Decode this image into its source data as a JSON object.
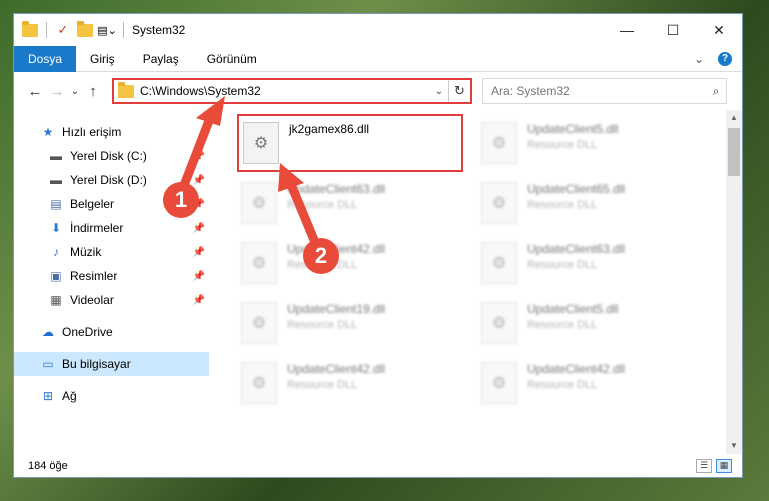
{
  "window": {
    "title": "System32",
    "controls": {
      "minimize": "—",
      "maximize": "☐",
      "close": "✕"
    }
  },
  "ribbon": {
    "tabs": [
      {
        "label": "Dosya",
        "active": true
      },
      {
        "label": "Giriş"
      },
      {
        "label": "Paylaş"
      },
      {
        "label": "Görünüm"
      }
    ]
  },
  "address_bar": {
    "path": "C:\\Windows\\System32",
    "refresh_icon": "↻",
    "dropdown_icon": "⌄"
  },
  "search": {
    "placeholder": "Ara: System32",
    "icon": "⌕"
  },
  "nav_arrows": {
    "back": "←",
    "forward": "→",
    "recent": "⌄",
    "up": "↑"
  },
  "sidebar": {
    "items": [
      {
        "label": "Hızlı erişim",
        "icon": "★"
      },
      {
        "label": "Yerel Disk (C:)",
        "icon": "▬"
      },
      {
        "label": "Yerel Disk (D:)",
        "icon": "▬"
      },
      {
        "label": "Belgeler",
        "icon": "▤"
      },
      {
        "label": "İndirmeler",
        "icon": "⬇"
      },
      {
        "label": "Müzik",
        "icon": "♪"
      },
      {
        "label": "Resimler",
        "icon": "▣"
      },
      {
        "label": "Videolar",
        "icon": "▦"
      },
      {
        "label": "OneDrive",
        "icon": "☁"
      },
      {
        "label": "Bu bilgisayar",
        "icon": "▭"
      },
      {
        "label": "Ağ",
        "icon": "⊞"
      }
    ]
  },
  "files": [
    {
      "name": "jk2gamex86.dll",
      "type": ""
    },
    {
      "name": "UpdateClient5.dll",
      "type": "Resource DLL"
    },
    {
      "name": "UpdateClient63.dll",
      "type": "Resource DLL"
    },
    {
      "name": "UpdateClient65.dll",
      "type": "Resource DLL"
    },
    {
      "name": "UpdateClient42.dll",
      "type": "Resource DLL"
    },
    {
      "name": "UpdateClient63.dll",
      "type": "Resource DLL"
    },
    {
      "name": "UpdateClient19.dll",
      "type": "Resource DLL"
    },
    {
      "name": "UpdateClient5.dll",
      "type": "Resource DLL"
    },
    {
      "name": "UpdateClient42.dll",
      "type": "Resource DLL"
    },
    {
      "name": "UpdateClient42.dll",
      "type": "Resource DLL"
    }
  ],
  "status": {
    "item_count": "184 öğe"
  },
  "annotations": {
    "step1": "1",
    "step2": "2",
    "accent": "#e84b3a"
  }
}
